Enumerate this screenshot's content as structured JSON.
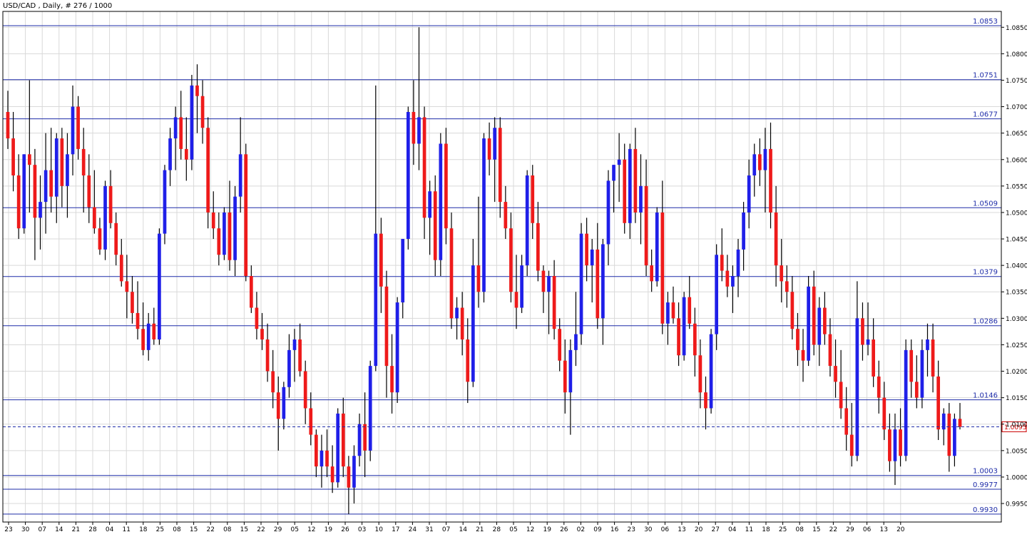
{
  "header": {
    "title": "USD/CAD , Daily, # 276 / 1000"
  },
  "colors": {
    "bull": "#1f1fe8",
    "bear": "#ee1a1a",
    "wick": "#000000",
    "level_line": "#1e2ca8",
    "level_label": "#1e2ca8",
    "current_price": "#cc0000",
    "grid": "#d9d9d9",
    "frame": "#000000"
  },
  "chart_data": {
    "type": "candlestick",
    "title": "USD/CAD , Daily, # 276 / 1000",
    "ylim": [
      0.9915,
      1.088
    ],
    "y_ticks": [
      1.085,
      1.08,
      1.075,
      1.07,
      1.065,
      1.06,
      1.055,
      1.05,
      1.045,
      1.04,
      1.035,
      1.03,
      1.025,
      1.02,
      1.015,
      1.01,
      1.005,
      1.0,
      0.995
    ],
    "x_tick_labels": [
      "23",
      "30",
      "07",
      "14",
      "21",
      "28",
      "04",
      "11",
      "18",
      "25",
      "08",
      "15",
      "22",
      "08",
      "15",
      "22",
      "29",
      "05",
      "12",
      "19",
      "26",
      "03",
      "10",
      "17",
      "24",
      "31",
      "07",
      "14",
      "21",
      "28",
      "05",
      "12",
      "19",
      "26",
      "02",
      "09",
      "16",
      "23",
      "30",
      "06",
      "13",
      "20",
      "27",
      "04",
      "11",
      "18",
      "25",
      "08",
      "15",
      "22",
      "29",
      "06",
      "13",
      "20"
    ],
    "levels": [
      1.0853,
      1.0751,
      1.0677,
      1.0509,
      1.0379,
      1.0286,
      1.0146,
      1.0003,
      0.9977,
      0.993
    ],
    "level_labels": [
      "1.0853",
      "1.0751",
      "1.0677",
      "1.0509",
      "1.0379",
      "1.0286",
      "1.0146",
      "1.0003",
      "0.9977",
      "0.9930"
    ],
    "current_price": 1.0095,
    "current_price_label": "1.0095",
    "candles": [
      [
        1.069,
        1.073,
        1.062,
        1.064
      ],
      [
        1.064,
        1.069,
        1.054,
        1.057
      ],
      [
        1.057,
        1.061,
        1.045,
        1.047
      ],
      [
        1.047,
        1.061,
        1.046,
        1.061
      ],
      [
        1.061,
        1.075,
        1.05,
        1.059
      ],
      [
        1.059,
        1.062,
        1.041,
        1.049
      ],
      [
        1.049,
        1.057,
        1.043,
        1.052
      ],
      [
        1.052,
        1.065,
        1.046,
        1.058
      ],
      [
        1.058,
        1.066,
        1.05,
        1.053
      ],
      [
        1.053,
        1.065,
        1.048,
        1.064
      ],
      [
        1.064,
        1.066,
        1.051,
        1.055
      ],
      [
        1.055,
        1.065,
        1.049,
        1.061
      ],
      [
        1.061,
        1.074,
        1.057,
        1.07
      ],
      [
        1.07,
        1.072,
        1.06,
        1.062
      ],
      [
        1.062,
        1.066,
        1.05,
        1.057
      ],
      [
        1.057,
        1.061,
        1.048,
        1.051
      ],
      [
        1.051,
        1.058,
        1.046,
        1.047
      ],
      [
        1.047,
        1.049,
        1.042,
        1.043
      ],
      [
        1.043,
        1.056,
        1.041,
        1.055
      ],
      [
        1.055,
        1.058,
        1.047,
        1.048
      ],
      [
        1.048,
        1.05,
        1.04,
        1.042
      ],
      [
        1.042,
        1.045,
        1.036,
        1.037
      ],
      [
        1.037,
        1.042,
        1.03,
        1.035
      ],
      [
        1.035,
        1.038,
        1.029,
        1.031
      ],
      [
        1.031,
        1.037,
        1.026,
        1.028
      ],
      [
        1.028,
        1.033,
        1.023,
        1.024
      ],
      [
        1.024,
        1.031,
        1.022,
        1.029
      ],
      [
        1.029,
        1.032,
        1.025,
        1.026
      ],
      [
        1.026,
        1.047,
        1.025,
        1.046
      ],
      [
        1.046,
        1.059,
        1.044,
        1.058
      ],
      [
        1.058,
        1.066,
        1.055,
        1.064
      ],
      [
        1.064,
        1.07,
        1.058,
        1.068
      ],
      [
        1.068,
        1.073,
        1.06,
        1.062
      ],
      [
        1.062,
        1.068,
        1.056,
        1.06
      ],
      [
        1.06,
        1.076,
        1.058,
        1.074
      ],
      [
        1.074,
        1.078,
        1.065,
        1.072
      ],
      [
        1.072,
        1.075,
        1.063,
        1.066
      ],
      [
        1.066,
        1.068,
        1.047,
        1.05
      ],
      [
        1.05,
        1.054,
        1.045,
        1.047
      ],
      [
        1.047,
        1.05,
        1.04,
        1.042
      ],
      [
        1.042,
        1.051,
        1.041,
        1.05
      ],
      [
        1.05,
        1.056,
        1.039,
        1.041
      ],
      [
        1.041,
        1.055,
        1.038,
        1.053
      ],
      [
        1.053,
        1.068,
        1.05,
        1.061
      ],
      [
        1.061,
        1.063,
        1.037,
        1.038
      ],
      [
        1.038,
        1.04,
        1.031,
        1.032
      ],
      [
        1.032,
        1.035,
        1.026,
        1.028
      ],
      [
        1.028,
        1.031,
        1.024,
        1.026
      ],
      [
        1.026,
        1.029,
        1.018,
        1.02
      ],
      [
        1.02,
        1.024,
        1.013,
        1.016
      ],
      [
        1.016,
        1.019,
        1.005,
        1.011
      ],
      [
        1.011,
        1.018,
        1.009,
        1.017
      ],
      [
        1.017,
        1.027,
        1.015,
        1.024
      ],
      [
        1.024,
        1.028,
        1.018,
        1.026
      ],
      [
        1.026,
        1.029,
        1.019,
        1.02
      ],
      [
        1.02,
        1.022,
        1.01,
        1.013
      ],
      [
        1.013,
        1.016,
        1.006,
        1.008
      ],
      [
        1.008,
        1.009,
        1.0,
        1.002
      ],
      [
        1.002,
        1.008,
        0.998,
        1.005
      ],
      [
        1.005,
        1.009,
        1.0,
        1.002
      ],
      [
        1.002,
        1.006,
        0.997,
        0.999
      ],
      [
        0.999,
        1.013,
        0.998,
        1.012
      ],
      [
        1.012,
        1.015,
        1.0,
        1.002
      ],
      [
        1.002,
        1.004,
        0.993,
        0.998
      ],
      [
        0.998,
        1.006,
        0.995,
        1.004
      ],
      [
        1.004,
        1.012,
        1.002,
        1.01
      ],
      [
        1.01,
        1.016,
        1.0,
        1.005
      ],
      [
        1.005,
        1.022,
        1.003,
        1.021
      ],
      [
        1.021,
        1.074,
        1.02,
        1.046
      ],
      [
        1.046,
        1.049,
        1.031,
        1.036
      ],
      [
        1.036,
        1.039,
        1.015,
        1.021
      ],
      [
        1.021,
        1.027,
        1.012,
        1.016
      ],
      [
        1.016,
        1.034,
        1.014,
        1.033
      ],
      [
        1.033,
        1.045,
        1.03,
        1.045
      ],
      [
        1.045,
        1.07,
        1.043,
        1.069
      ],
      [
        1.069,
        1.075,
        1.059,
        1.063
      ],
      [
        1.063,
        1.085,
        1.058,
        1.068
      ],
      [
        1.068,
        1.07,
        1.045,
        1.049
      ],
      [
        1.049,
        1.056,
        1.042,
        1.054
      ],
      [
        1.054,
        1.057,
        1.038,
        1.041
      ],
      [
        1.041,
        1.065,
        1.038,
        1.063
      ],
      [
        1.063,
        1.066,
        1.044,
        1.047
      ],
      [
        1.047,
        1.05,
        1.028,
        1.03
      ],
      [
        1.03,
        1.034,
        1.026,
        1.032
      ],
      [
        1.032,
        1.035,
        1.023,
        1.026
      ],
      [
        1.026,
        1.03,
        1.014,
        1.018
      ],
      [
        1.018,
        1.045,
        1.017,
        1.04
      ],
      [
        1.04,
        1.053,
        1.032,
        1.035
      ],
      [
        1.035,
        1.065,
        1.033,
        1.064
      ],
      [
        1.064,
        1.067,
        1.057,
        1.06
      ],
      [
        1.06,
        1.068,
        1.052,
        1.066
      ],
      [
        1.066,
        1.068,
        1.049,
        1.052
      ],
      [
        1.052,
        1.055,
        1.045,
        1.047
      ],
      [
        1.047,
        1.05,
        1.033,
        1.035
      ],
      [
        1.035,
        1.042,
        1.028,
        1.032
      ],
      [
        1.032,
        1.042,
        1.031,
        1.04
      ],
      [
        1.04,
        1.058,
        1.038,
        1.057
      ],
      [
        1.057,
        1.059,
        1.045,
        1.048
      ],
      [
        1.048,
        1.052,
        1.037,
        1.039
      ],
      [
        1.039,
        1.04,
        1.031,
        1.035
      ],
      [
        1.035,
        1.039,
        1.027,
        1.038
      ],
      [
        1.038,
        1.041,
        1.026,
        1.028
      ],
      [
        1.028,
        1.03,
        1.02,
        1.022
      ],
      [
        1.022,
        1.026,
        1.012,
        1.016
      ],
      [
        1.016,
        1.026,
        1.008,
        1.024
      ],
      [
        1.024,
        1.035,
        1.021,
        1.027
      ],
      [
        1.027,
        1.048,
        1.025,
        1.046
      ],
      [
        1.046,
        1.049,
        1.037,
        1.04
      ],
      [
        1.04,
        1.045,
        1.033,
        1.043
      ],
      [
        1.043,
        1.048,
        1.028,
        1.03
      ],
      [
        1.03,
        1.045,
        1.025,
        1.044
      ],
      [
        1.044,
        1.058,
        1.04,
        1.056
      ],
      [
        1.056,
        1.059,
        1.05,
        1.059
      ],
      [
        1.059,
        1.065,
        1.052,
        1.06
      ],
      [
        1.06,
        1.063,
        1.046,
        1.048
      ],
      [
        1.048,
        1.063,
        1.045,
        1.062
      ],
      [
        1.062,
        1.066,
        1.048,
        1.05
      ],
      [
        1.05,
        1.061,
        1.044,
        1.055
      ],
      [
        1.055,
        1.06,
        1.038,
        1.04
      ],
      [
        1.04,
        1.043,
        1.035,
        1.037
      ],
      [
        1.037,
        1.051,
        1.036,
        1.05
      ],
      [
        1.05,
        1.056,
        1.027,
        1.029
      ],
      [
        1.029,
        1.035,
        1.025,
        1.033
      ],
      [
        1.033,
        1.036,
        1.029,
        1.03
      ],
      [
        1.03,
        1.033,
        1.021,
        1.023
      ],
      [
        1.023,
        1.035,
        1.022,
        1.034
      ],
      [
        1.034,
        1.038,
        1.028,
        1.029
      ],
      [
        1.029,
        1.032,
        1.019,
        1.023
      ],
      [
        1.023,
        1.026,
        1.013,
        1.016
      ],
      [
        1.016,
        1.019,
        1.009,
        1.013
      ],
      [
        1.013,
        1.028,
        1.012,
        1.027
      ],
      [
        1.027,
        1.044,
        1.024,
        1.042
      ],
      [
        1.042,
        1.047,
        1.037,
        1.039
      ],
      [
        1.039,
        1.042,
        1.034,
        1.036
      ],
      [
        1.036,
        1.04,
        1.031,
        1.038
      ],
      [
        1.038,
        1.045,
        1.034,
        1.043
      ],
      [
        1.043,
        1.052,
        1.039,
        1.05
      ],
      [
        1.05,
        1.06,
        1.047,
        1.057
      ],
      [
        1.057,
        1.063,
        1.053,
        1.061
      ],
      [
        1.061,
        1.064,
        1.055,
        1.058
      ],
      [
        1.058,
        1.066,
        1.05,
        1.062
      ],
      [
        1.062,
        1.067,
        1.047,
        1.05
      ],
      [
        1.05,
        1.055,
        1.036,
        1.04
      ],
      [
        1.04,
        1.045,
        1.033,
        1.037
      ],
      [
        1.037,
        1.04,
        1.032,
        1.035
      ],
      [
        1.035,
        1.038,
        1.026,
        1.028
      ],
      [
        1.028,
        1.031,
        1.021,
        1.024
      ],
      [
        1.024,
        1.028,
        1.018,
        1.022
      ],
      [
        1.022,
        1.038,
        1.021,
        1.036
      ],
      [
        1.036,
        1.039,
        1.023,
        1.025
      ],
      [
        1.025,
        1.034,
        1.021,
        1.032
      ],
      [
        1.032,
        1.035,
        1.025,
        1.027
      ],
      [
        1.027,
        1.03,
        1.019,
        1.021
      ],
      [
        1.021,
        1.026,
        1.015,
        1.018
      ],
      [
        1.018,
        1.024,
        1.011,
        1.013
      ],
      [
        1.013,
        1.017,
        1.005,
        1.008
      ],
      [
        1.008,
        1.014,
        1.002,
        1.004
      ],
      [
        1.004,
        1.037,
        1.003,
        1.03
      ],
      [
        1.03,
        1.033,
        1.022,
        1.025
      ],
      [
        1.025,
        1.033,
        1.023,
        1.026
      ],
      [
        1.026,
        1.03,
        1.017,
        1.019
      ],
      [
        1.019,
        1.022,
        1.012,
        1.015
      ],
      [
        1.015,
        1.018,
        1.007,
        1.009
      ],
      [
        1.009,
        1.012,
        1.001,
        1.003
      ],
      [
        1.003,
        1.012,
        0.9985,
        1.009
      ],
      [
        1.009,
        1.013,
        1.002,
        1.004
      ],
      [
        1.004,
        1.026,
        1.003,
        1.024
      ],
      [
        1.024,
        1.026,
        1.015,
        1.018
      ],
      [
        1.018,
        1.023,
        1.013,
        1.015
      ],
      [
        1.015,
        1.026,
        1.013,
        1.024
      ],
      [
        1.024,
        1.029,
        1.019,
        1.026
      ],
      [
        1.026,
        1.029,
        1.016,
        1.019
      ],
      [
        1.019,
        1.022,
        1.007,
        1.009
      ],
      [
        1.009,
        1.013,
        1.006,
        1.012
      ],
      [
        1.012,
        1.014,
        1.001,
        1.004
      ],
      [
        1.004,
        1.012,
        1.002,
        1.011
      ],
      [
        1.011,
        1.014,
        1.009,
        1.0095
      ]
    ]
  }
}
